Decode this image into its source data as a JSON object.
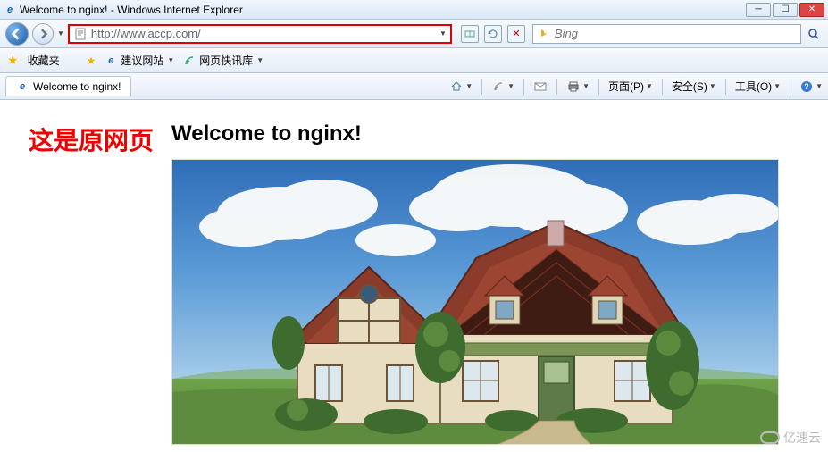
{
  "window": {
    "title": "Welcome to nginx! - Windows Internet Explorer"
  },
  "nav": {
    "url": "http://www.accp.com/",
    "search_placeholder": "Bing"
  },
  "favorites": {
    "label": "收藏夹",
    "items": [
      "建议网站",
      "网页快讯库"
    ]
  },
  "tab": {
    "title": "Welcome to nginx!"
  },
  "commands": {
    "page": "页面(P)",
    "safety": "安全(S)",
    "tools": "工具(O)"
  },
  "content": {
    "red_label": "这是原网页",
    "heading": "Welcome to nginx!"
  },
  "watermark": {
    "text": "亿速云"
  }
}
